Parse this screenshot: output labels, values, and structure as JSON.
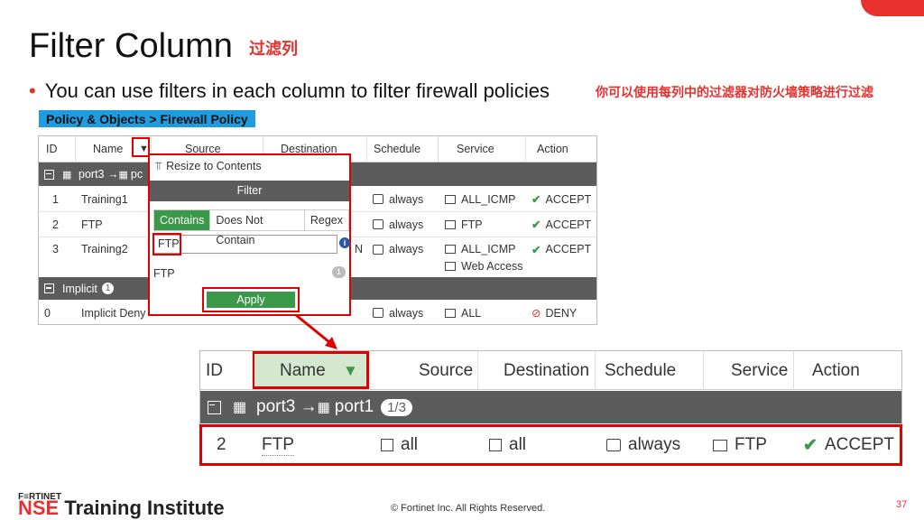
{
  "slide": {
    "title": "Filter Column",
    "title_cn": "过滤列",
    "bullet": "You can use filters in each column to filter firewall policies",
    "bullet_cn": "你可以使用每列中的过滤器对防火墙策略进行过滤",
    "breadcrumb": "Policy & Objects > Firewall Policy",
    "page_number": "37",
    "copyright": "© Fortinet Inc. All Rights Reserved.",
    "logo_small": "F≡RTINET",
    "logo_nse": "NSE",
    "logo_rest": " Training Institute",
    "accent_color": "#e8312f"
  },
  "table1": {
    "headers": [
      "ID",
      "Name",
      "Source",
      "Destination",
      "Schedule",
      "Service",
      "Action"
    ],
    "group1": {
      "label": "port3 → ",
      "label_rest": "pc"
    },
    "rows": [
      {
        "id": "1",
        "name": "Training1",
        "schedule": "always",
        "service": "ALL_ICMP",
        "service2": "",
        "action": "ACCEPT"
      },
      {
        "id": "2",
        "name": "FTP",
        "schedule": "always",
        "service": "FTP",
        "service2": "",
        "action": "ACCEPT"
      },
      {
        "id": "3",
        "name": "Training2",
        "dest_tail": "N",
        "schedule": "always",
        "service": "ALL_ICMP",
        "service2": "Web Access",
        "action": "ACCEPT"
      }
    ],
    "group2": {
      "label": "Implicit",
      "count": "1"
    },
    "implicit_row": {
      "id": "0",
      "name": "Implicit Deny",
      "schedule": "always",
      "service": "ALL",
      "action": "DENY"
    }
  },
  "filter_popup": {
    "resize_label": "Resize to Contents",
    "filter_header": "Filter",
    "tabs": [
      "Contains",
      "Does Not Contain",
      "Regex"
    ],
    "active_tab": "Contains",
    "input_value": "FTP",
    "info_glyph": "i",
    "result_label": "FTP",
    "result_count": "1",
    "apply_label": "Apply"
  },
  "table2": {
    "headers": [
      "ID",
      "Name",
      "Source",
      "Destination",
      "Schedule",
      "Service",
      "Action"
    ],
    "group": {
      "label": "port3 → ",
      "label_rest": "port1",
      "count": "1/3"
    },
    "row": {
      "id": "2",
      "name": "FTP",
      "source": "all",
      "destination": "all",
      "schedule": "always",
      "service": "FTP",
      "action": "ACCEPT"
    }
  }
}
